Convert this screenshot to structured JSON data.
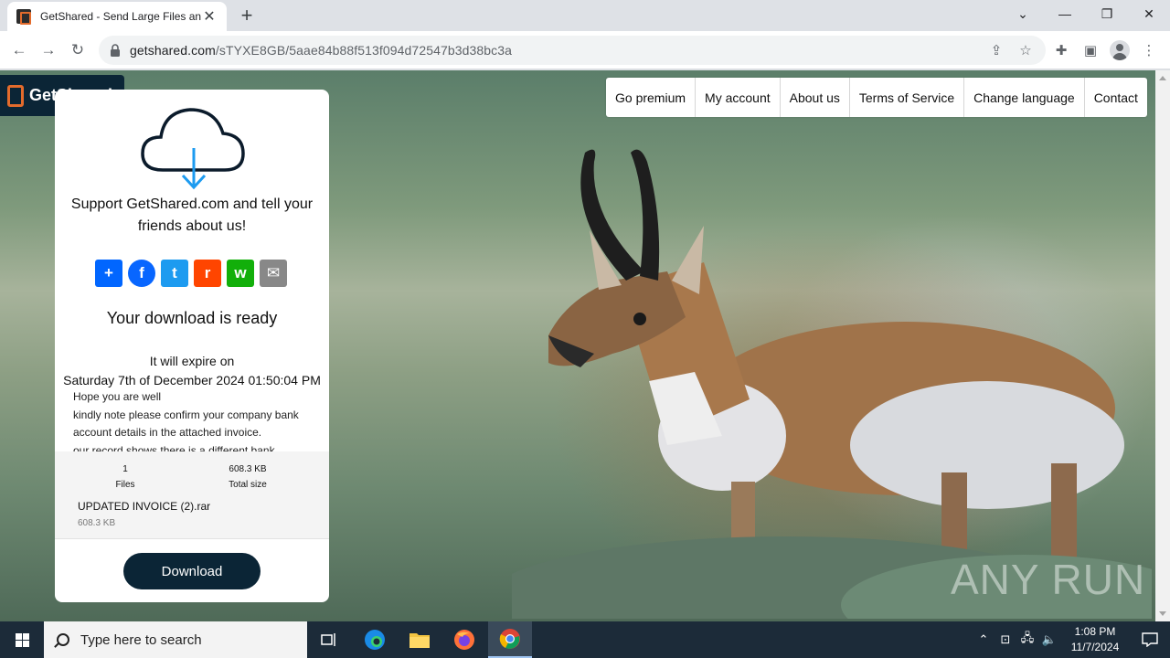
{
  "browser": {
    "tab_title": "GetShared - Send Large Files and",
    "url_host": "getshared.com",
    "url_path": "/sTYXE8GB/5aae84b88f513f094d72547b3d38bc3a"
  },
  "site": {
    "logo_text": "GetShared",
    "menu": [
      "Go premium",
      "My account",
      "About us",
      "Terms of Service",
      "Change language",
      "Contact"
    ]
  },
  "card": {
    "support_text": "Support GetShared.com and tell your friends about us!",
    "share_buttons": [
      {
        "name": "share-button",
        "glyph": "+",
        "color": "#0166ff"
      },
      {
        "name": "facebook-button",
        "glyph": "f",
        "color": "#0866ff"
      },
      {
        "name": "twitter-button",
        "glyph": "t",
        "color": "#1d9bf0"
      },
      {
        "name": "reddit-button",
        "glyph": "r",
        "color": "#ff4500"
      },
      {
        "name": "whatsapp-button",
        "glyph": "w",
        "color": "#12af0a"
      },
      {
        "name": "email-button",
        "glyph": "✉",
        "color": "#888888"
      }
    ],
    "ready_title": "Your download is ready",
    "expire_label": "It will expire on",
    "expire_date": "Saturday 7th of December 2024 01:50:04 PM",
    "message_lines": [
      "Hope you are well",
      "kindly note please confirm your company bank account details in the attached invoice.",
      "our record shows there is a different bank"
    ],
    "files_count": "1",
    "files_label": "Files",
    "total_size": "608.3 KB",
    "total_size_label": "Total size",
    "file_name": "UPDATED INVOICE (2).rar",
    "file_size": "608.3 KB",
    "download_label": "Download"
  },
  "watermark": "ANY RUN",
  "taskbar": {
    "search_placeholder": "Type here to search",
    "time": "1:08 PM",
    "date": "11/7/2024"
  }
}
